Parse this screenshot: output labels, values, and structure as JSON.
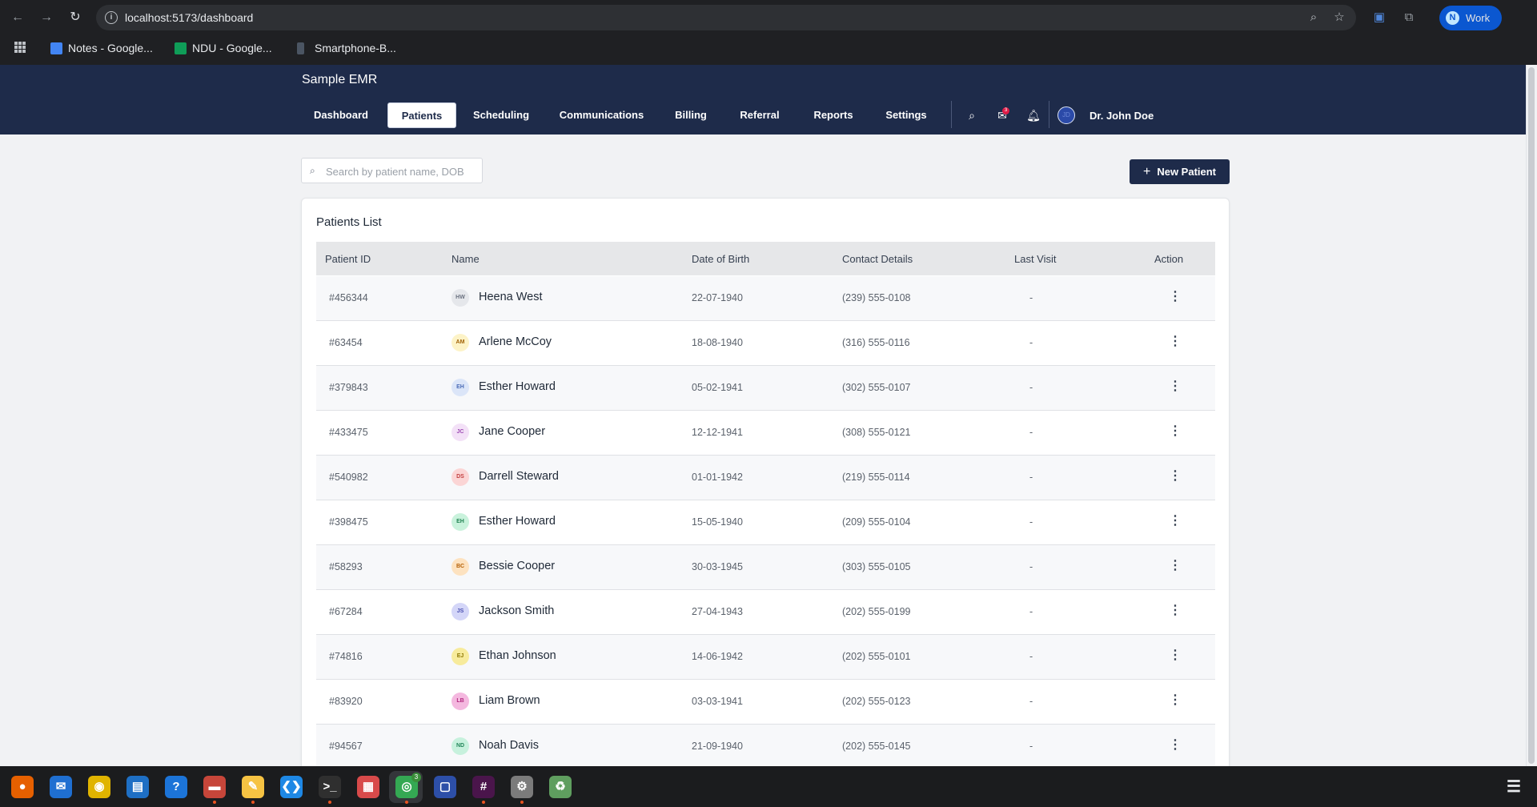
{
  "browser": {
    "url": "localhost:5173/dashboard",
    "bookmarks": [
      {
        "label": "Notes - Google...",
        "color": "#4285f4"
      },
      {
        "label": "NDU - Google...",
        "color": "#0f9d58"
      },
      {
        "label": "Smartphone-B...",
        "color": "#4b5563"
      }
    ],
    "profile": {
      "initial": "N",
      "label": "Work"
    }
  },
  "app": {
    "title": "Sample EMR",
    "nav": [
      "Dashboard",
      "Patients",
      "Scheduling",
      "Communications",
      "Billing",
      "Referral",
      "Reports",
      "Settings"
    ],
    "active_tab": "Patients",
    "notification_count": "3",
    "user": {
      "name": "Dr. John Doe",
      "avatar": "JD"
    },
    "colors": {
      "primary": "#1e2b4a",
      "badge": "#e11d48"
    }
  },
  "toolbar": {
    "search_placeholder": "Search by patient name, DOB",
    "new_patient_label": "New Patient"
  },
  "patients": {
    "title": "Patients List",
    "columns": [
      "Patient ID",
      "Name",
      "Date of Birth",
      "Contact Details",
      "Last Visit",
      "Action"
    ],
    "rows": [
      {
        "id": "#456344",
        "initials": "HW",
        "name": "Heena West",
        "dob": "22-07-1940",
        "contact": "(239) 555-0108",
        "last_visit": "-",
        "bg": "#e5e7eb",
        "fg": "#6b7280"
      },
      {
        "id": "#63454",
        "initials": "AM",
        "name": "Arlene McCoy",
        "dob": "18-08-1940",
        "contact": "(316) 555-0116",
        "last_visit": "-",
        "bg": "#fdf3c7",
        "fg": "#a16207"
      },
      {
        "id": "#379843",
        "initials": "EH",
        "name": "Esther Howard",
        "dob": "05-02-1941",
        "contact": "(302) 555-0107",
        "last_visit": "-",
        "bg": "#dbe5f8",
        "fg": "#4b6cb7"
      },
      {
        "id": "#433475",
        "initials": "JC",
        "name": "Jane Cooper",
        "dob": "12-12-1941",
        "contact": "(308) 555-0121",
        "last_visit": "-",
        "bg": "#f3e1f7",
        "fg": "#9d4bb3"
      },
      {
        "id": "#540982",
        "initials": "DS",
        "name": "Darrell Steward",
        "dob": "01-01-1942",
        "contact": "(219) 555-0114",
        "last_visit": "-",
        "bg": "#fbd5d5",
        "fg": "#c24141"
      },
      {
        "id": "#398475",
        "initials": "EH",
        "name": "Esther Howard",
        "dob": "15-05-1940",
        "contact": "(209) 555-0104",
        "last_visit": "-",
        "bg": "#c9f2dc",
        "fg": "#238454"
      },
      {
        "id": "#58293",
        "initials": "BC",
        "name": "Bessie Cooper",
        "dob": "30-03-1945",
        "contact": "(303) 555-0105",
        "last_visit": "-",
        "bg": "#fde2c0",
        "fg": "#b45f06"
      },
      {
        "id": "#67284",
        "initials": "JS",
        "name": "Jackson Smith",
        "dob": "27-04-1943",
        "contact": "(202) 555-0199",
        "last_visit": "-",
        "bg": "#d4d6f8",
        "fg": "#4a4fb0"
      },
      {
        "id": "#74816",
        "initials": "EJ",
        "name": "Ethan Johnson",
        "dob": "14-06-1942",
        "contact": "(202) 555-0101",
        "last_visit": "-",
        "bg": "#f7eb9c",
        "fg": "#8f7a05"
      },
      {
        "id": "#83920",
        "initials": "LB",
        "name": "Liam Brown",
        "dob": "03-03-1941",
        "contact": "(202) 555-0123",
        "last_visit": "-",
        "bg": "#f4b8df",
        "fg": "#b3287f"
      },
      {
        "id": "#94567",
        "initials": "ND",
        "name": "Noah Davis",
        "dob": "21-09-1940",
        "contact": "(202) 555-0145",
        "last_visit": "-",
        "bg": "#c7f1dd",
        "fg": "#23865a"
      }
    ]
  },
  "taskbar": {
    "apps": [
      {
        "name": "firefox-icon",
        "glyph": "●",
        "color": "#e66000",
        "running": false
      },
      {
        "name": "thunderbird-icon",
        "glyph": "✉",
        "color": "#1f6fd1",
        "running": false
      },
      {
        "name": "rhythmbox-icon",
        "glyph": "◉",
        "color": "#e0b400",
        "running": false
      },
      {
        "name": "writer-icon",
        "glyph": "▤",
        "color": "#1e6fc4",
        "running": false
      },
      {
        "name": "help-icon",
        "glyph": "?",
        "color": "#1c74d8",
        "running": false
      },
      {
        "name": "files-icon",
        "glyph": "▬",
        "color": "#c7463a",
        "running": true
      },
      {
        "name": "text-editor-icon",
        "glyph": "✎",
        "color": "#f6c343",
        "running": true
      },
      {
        "name": "vscode-icon",
        "glyph": "❮❯",
        "color": "#1e88e5",
        "running": false
      },
      {
        "name": "terminal-icon",
        "glyph": ">_",
        "color": "#2f2f2f",
        "running": true
      },
      {
        "name": "screenshot-icon",
        "glyph": "▦",
        "color": "#d84a4a",
        "running": false
      },
      {
        "name": "chrome-icon",
        "glyph": "◎",
        "color": "#34a853",
        "running": true,
        "badge": "3"
      },
      {
        "name": "remote-desktop-icon",
        "glyph": "▢",
        "color": "#2d4fa8",
        "running": false
      },
      {
        "name": "slack-icon",
        "glyph": "#",
        "color": "#4a154b",
        "running": true
      },
      {
        "name": "settings-icon",
        "glyph": "⚙",
        "color": "#7b7b7b",
        "running": true
      },
      {
        "name": "trash-icon",
        "glyph": "♻",
        "color": "#5f9e5f",
        "running": false
      }
    ],
    "system_menu": "☰"
  }
}
